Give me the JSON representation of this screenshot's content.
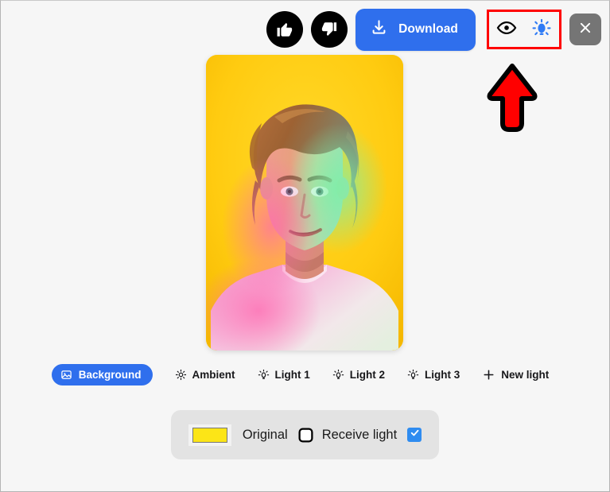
{
  "toolbar": {
    "thumbs_up": {
      "label": "Thumbs up",
      "icon": "thumbs-up-icon"
    },
    "thumbs_down": {
      "label": "Thumbs down",
      "icon": "thumbs-down-icon"
    },
    "download_label": "Download",
    "download_icon": "download-icon",
    "preview_icon": "eye-icon",
    "light_toggle_icon": "light-bulb-icon",
    "close_icon": "close-icon",
    "accent_blue": "#2f6fed",
    "close_bg": "#757575"
  },
  "annotation": {
    "highlight_box_color": "#ff0000",
    "arrow_fill": "#ff0000",
    "arrow_outline": "#000000",
    "arrow_direction": "up"
  },
  "preview": {
    "background_color": "#ffcf1a",
    "light_green": "#8fe8a8",
    "light_pink": "#ff8fc8",
    "alt": "Portrait photo with colored studio lighting on yellow background"
  },
  "lights": {
    "tabs": [
      {
        "label": "Background",
        "icon": "image-icon",
        "active": true
      },
      {
        "label": "Ambient",
        "icon": "sun-icon",
        "active": false
      },
      {
        "label": "Light 1",
        "icon": "light-bulb-icon",
        "active": false
      },
      {
        "label": "Light 2",
        "icon": "light-bulb-icon",
        "active": false
      },
      {
        "label": "Light 3",
        "icon": "light-bulb-icon",
        "active": false
      },
      {
        "label": "New light",
        "icon": "plus-icon",
        "active": false
      }
    ]
  },
  "properties": {
    "color_swatch_value": "#fce517",
    "color_mode_label": "Original",
    "receive_light_label": "Receive light",
    "receive_light_icon": "square-icon",
    "receive_light_checked": true,
    "checkbox_color": "#2f8cf0"
  }
}
